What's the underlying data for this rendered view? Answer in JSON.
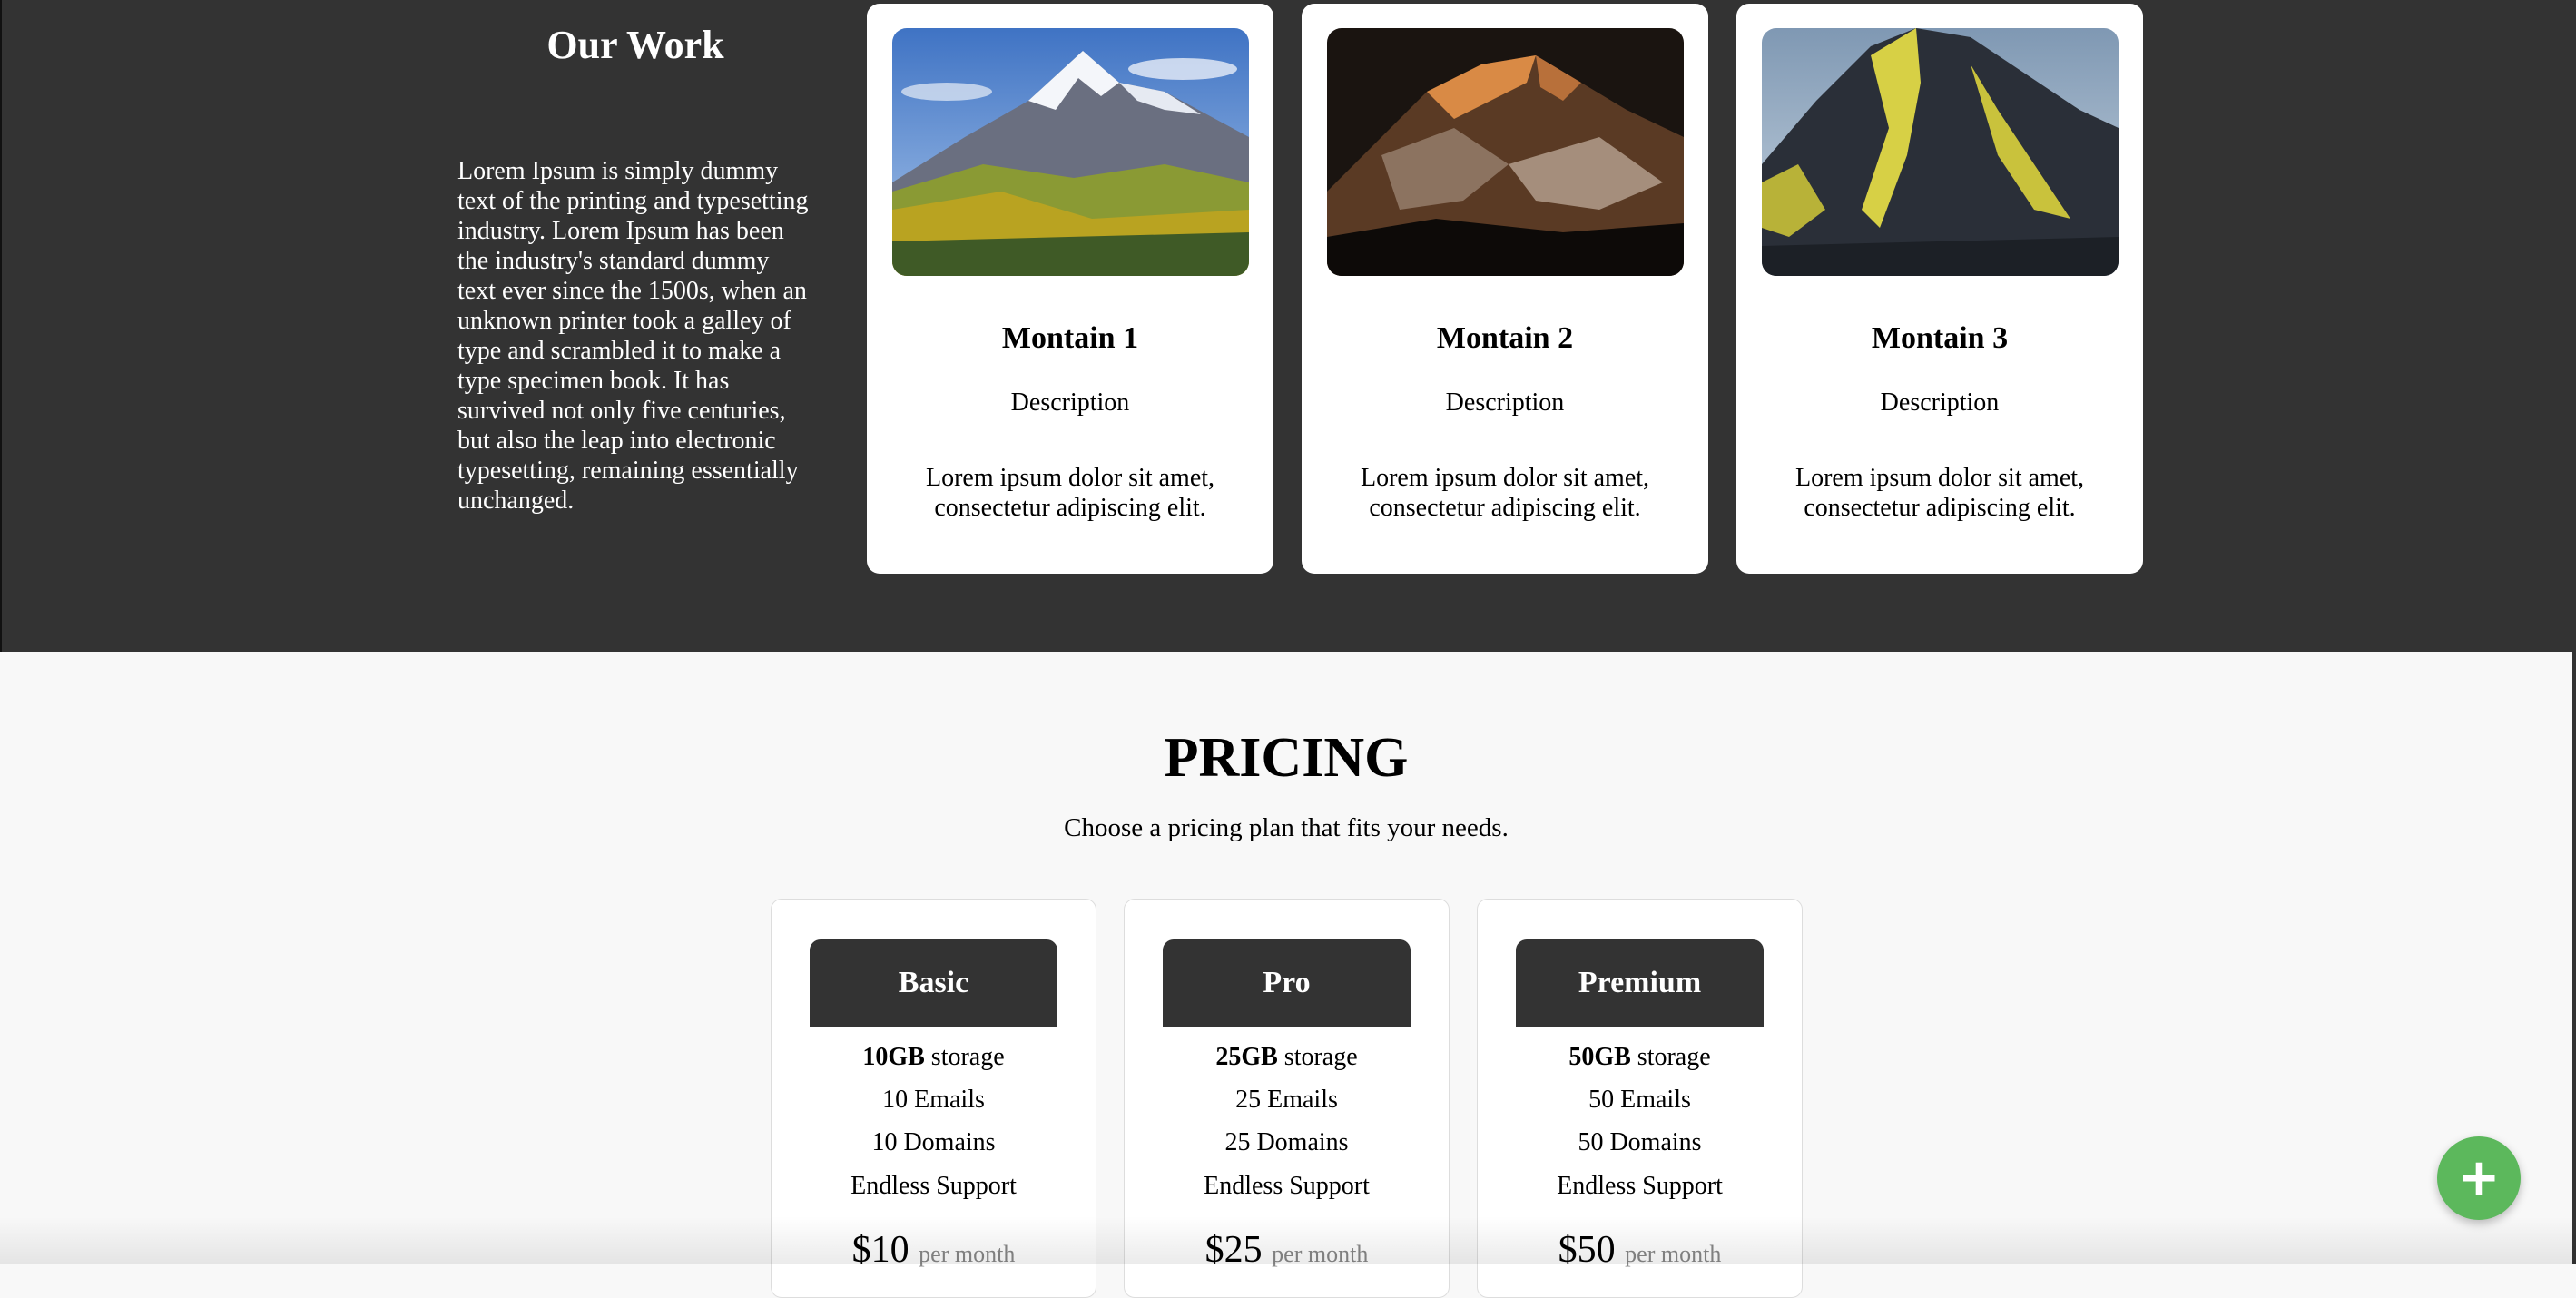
{
  "work": {
    "title": "Our Work",
    "text": "Lorem Ipsum is simply dummy text of the printing and typesetting industry. Lorem Ipsum has been the industry's standard dummy text ever since the 1500s, when an unknown printer took a galley of type and scrambled it to make a type specimen book. It has survived not only five centuries, but also the leap into electronic typesetting, remaining essentially unchanged.",
    "cards": [
      {
        "title": "Montain 1",
        "description": "Description",
        "text": "Lorem ipsum dolor sit amet, consectetur adipiscing elit."
      },
      {
        "title": "Montain 2",
        "description": "Description",
        "text": "Lorem ipsum dolor sit amet, consectetur adipiscing elit."
      },
      {
        "title": "Montain 3",
        "description": "Description",
        "text": "Lorem ipsum dolor sit amet, consectetur adipiscing elit."
      }
    ]
  },
  "pricing": {
    "title": "PRICING",
    "subtitle": "Choose a pricing plan that fits your needs.",
    "plans": [
      {
        "name": "Basic",
        "storage_amount": "10GB",
        "storage_label": " storage",
        "emails": "10 Emails",
        "domains": "10 Domains",
        "support": "Endless Support",
        "price": "$10",
        "period": "per month"
      },
      {
        "name": "Pro",
        "storage_amount": "25GB",
        "storage_label": " storage",
        "emails": "25 Emails",
        "domains": "25 Domains",
        "support": "Endless Support",
        "price": "$25",
        "period": "per month"
      },
      {
        "name": "Premium",
        "storage_amount": "50GB",
        "storage_label": " storage",
        "emails": "50 Emails",
        "domains": "50 Domains",
        "support": "Endless Support",
        "price": "$50",
        "period": "per month"
      }
    ]
  },
  "fab": {
    "icon": "plus-icon",
    "label": "+",
    "color": "#5cb85c"
  },
  "colors": {
    "dark_bg": "#333333",
    "page_bg": "#f8f8f8"
  }
}
